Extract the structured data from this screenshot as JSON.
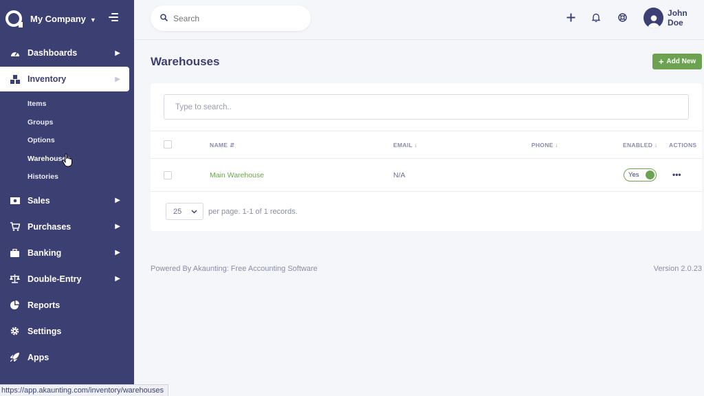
{
  "brand": {
    "company": "My Company"
  },
  "sidebar": {
    "items": [
      {
        "label": "Dashboards",
        "icon": "gauge-icon"
      },
      {
        "label": "Inventory",
        "icon": "cubes-icon"
      },
      {
        "label": "Sales",
        "icon": "money-icon"
      },
      {
        "label": "Purchases",
        "icon": "cart-icon"
      },
      {
        "label": "Banking",
        "icon": "briefcase-icon"
      },
      {
        "label": "Double-Entry",
        "icon": "scale-icon"
      },
      {
        "label": "Reports",
        "icon": "pie-chart-icon"
      },
      {
        "label": "Settings",
        "icon": "gear-icon"
      },
      {
        "label": "Apps",
        "icon": "rocket-icon"
      }
    ],
    "inventory_sub": [
      "Items",
      "Groups",
      "Options",
      "Warehouses",
      "Histories"
    ]
  },
  "topbar": {
    "search_placeholder": "Search",
    "user_name": "John Doe"
  },
  "page": {
    "title": "Warehouses",
    "add_new_label": "Add New"
  },
  "table": {
    "filter_placeholder": "Type to search..",
    "headers": {
      "name": "NAME",
      "email": "EMAIL",
      "phone": "PHONE",
      "enabled": "ENABLED",
      "actions": "ACTIONS"
    },
    "rows": [
      {
        "name": "Main Warehouse",
        "email": "N/A",
        "phone": "",
        "enabled": "Yes"
      }
    ],
    "per_page": "25",
    "pagination_text": "per page. 1-1 of 1 records."
  },
  "footer": {
    "powered_by": "Powered By Akaunting: Free Accounting Software",
    "version": "Version 2.0.23"
  },
  "status_url": "https://app.akaunting.com/inventory/warehouses",
  "colors": {
    "sidebar": "#3c3f72",
    "accent_green": "#6da252",
    "background": "#f5f6fa"
  }
}
